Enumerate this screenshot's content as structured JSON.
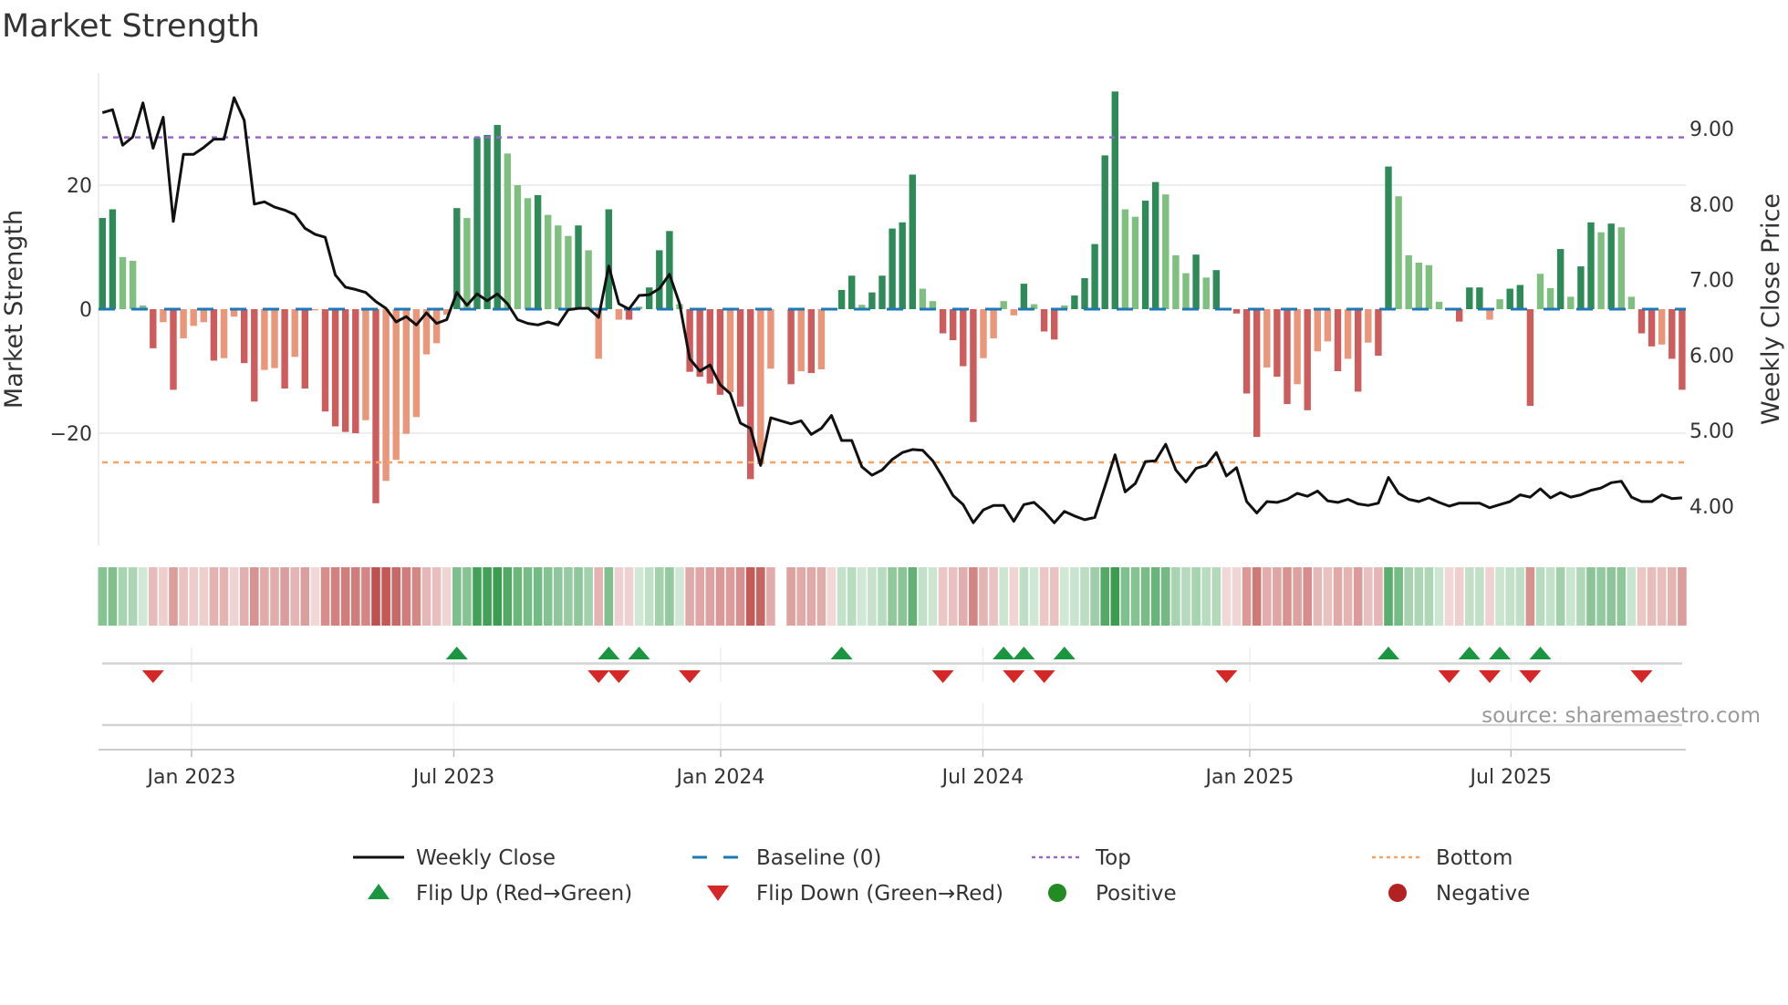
{
  "title": "Market Strength",
  "source": "source: sharemaestro.com",
  "colors": {
    "pos_strong": "#2e8b57",
    "pos_weak": "#7fbf7f",
    "neg_strong": "#cd5c5c",
    "neg_weak": "#e9967a",
    "price_line": "#111111",
    "baseline": "#1f77b4",
    "top": "#9966cc",
    "bottom": "#f4a460",
    "flip_up": "#1a9641",
    "flip_down": "#d62728",
    "positive": "#228b22",
    "negative": "#b22222",
    "strip_green": "#3a9d4f",
    "strip_red": "#c0504d"
  },
  "chart_data": {
    "type": "bar",
    "title": "Market Strength",
    "ylabel": "Market Strength",
    "y2label": "Weekly Close Price",
    "ylim": [
      -38,
      40
    ],
    "y2lim": [
      3.48,
      10.0
    ],
    "y_ticks": [
      {
        "value": 20,
        "label": "20"
      },
      {
        "value": 0,
        "label": "0"
      },
      {
        "value": -20,
        "label": "−20"
      }
    ],
    "y2_ticks": [
      {
        "value": 9,
        "label": "9.00"
      },
      {
        "value": 8,
        "label": "8.00"
      },
      {
        "value": 7,
        "label": "7.00"
      },
      {
        "value": 6,
        "label": "6.00"
      },
      {
        "value": 5,
        "label": "5.00"
      },
      {
        "value": 4,
        "label": "4.00"
      }
    ],
    "x_ticks": [
      "Jan 2023",
      "Jul 2023",
      "Jan 2024",
      "Jul 2024",
      "Jan 2025",
      "Jul 2025"
    ],
    "frequency": "weekly",
    "grid": true,
    "top_level": 27.7,
    "bottom_level": -24.7,
    "baseline": 0,
    "series": [
      {
        "name": "Market Strength",
        "type": "bar",
        "values": [
          14.7,
          16.1,
          8.4,
          7.8,
          0.6,
          -6.3,
          -2.1,
          -13.0,
          -4.7,
          -2.7,
          -2.1,
          -8.3,
          -7.9,
          -1.2,
          -8.7,
          -14.9,
          -9.8,
          -9.5,
          -12.8,
          -7.7,
          -12.8,
          -0.2,
          -16.5,
          -18.9,
          -19.8,
          -20.0,
          -17.9,
          -31.3,
          -27.7,
          -24.3,
          -20.1,
          -17.4,
          -7.3,
          -5.5,
          -0.9,
          16.3,
          14.7,
          27.7,
          28.1,
          29.7,
          25.1,
          20.0,
          17.9,
          18.4,
          15.2,
          13.5,
          11.8,
          13.5,
          9.5,
          -8.0,
          16.1,
          -1.7,
          -1.7,
          0.4,
          3.5,
          9.5,
          12.6,
          0.8,
          -10.1,
          -10.9,
          -12.0,
          -13.8,
          -13.4,
          -15.7,
          -27.4,
          -25.0,
          -9.6,
          null,
          -12.1,
          -10.0,
          -10.3,
          -9.7,
          -0.2,
          3.1,
          5.4,
          0.7,
          2.7,
          5.4,
          13.0,
          14.0,
          21.7,
          3.3,
          1.3,
          -3.9,
          -5.0,
          -9.2,
          -18.2,
          -7.9,
          -4.7,
          1.3,
          -1.0,
          4.1,
          0.8,
          -3.6,
          -4.9,
          0.6,
          2.2,
          5.0,
          10.5,
          24.8,
          35.1,
          16.1,
          14.9,
          17.5,
          20.5,
          18.5,
          8.7,
          5.8,
          8.8,
          5.1,
          6.3,
          -0.2,
          -0.7,
          -13.6,
          -20.6,
          -9.4,
          -10.9,
          -15.3,
          -12.1,
          -16.3,
          -6.8,
          -5.2,
          -10.0,
          -8.0,
          -13.3,
          -5.4,
          -7.5,
          23.0,
          18.2,
          8.7,
          7.5,
          7.1,
          1.2,
          -0.2,
          -2.0,
          3.5,
          3.5,
          -1.7,
          1.6,
          3.3,
          3.9,
          -15.6,
          5.7,
          3.4,
          9.7,
          2.0,
          6.9,
          14.0,
          12.4,
          13.8,
          13.2,
          2.0,
          -3.9,
          -6.0,
          -5.7,
          -8.0,
          -13.0
        ]
      },
      {
        "name": "Weekly Close",
        "type": "line",
        "axis": "right",
        "values": [
          9.21,
          9.25,
          8.78,
          8.89,
          9.34,
          8.74,
          9.15,
          7.77,
          8.66,
          8.66,
          8.75,
          8.86,
          8.86,
          9.41,
          9.11,
          8.0,
          8.03,
          7.96,
          7.92,
          7.86,
          7.68,
          7.6,
          7.56,
          7.06,
          6.9,
          6.87,
          6.83,
          6.71,
          6.62,
          6.44,
          6.51,
          6.4,
          6.56,
          6.42,
          6.47,
          6.83,
          6.66,
          6.81,
          6.72,
          6.81,
          6.68,
          6.47,
          6.42,
          6.4,
          6.44,
          6.4,
          6.6,
          6.62,
          6.62,
          6.5,
          7.18,
          6.68,
          6.61,
          6.79,
          6.8,
          6.88,
          7.07,
          6.68,
          5.95,
          5.79,
          5.87,
          5.61,
          5.49,
          5.1,
          5.03,
          4.54,
          5.17,
          5.13,
          5.09,
          5.13,
          4.95,
          5.03,
          5.2,
          4.87,
          4.87,
          4.52,
          4.41,
          4.48,
          4.62,
          4.71,
          4.75,
          4.74,
          4.6,
          4.38,
          4.14,
          4.02,
          3.78,
          3.95,
          4.01,
          4.01,
          3.8,
          4.02,
          4.05,
          3.93,
          3.78,
          3.93,
          3.87,
          3.82,
          3.85,
          4.26,
          4.68,
          4.19,
          4.3,
          4.59,
          4.6,
          4.82,
          4.48,
          4.32,
          4.5,
          4.54,
          4.71,
          4.4,
          4.51,
          4.06,
          3.91,
          4.06,
          4.05,
          4.09,
          4.17,
          4.13,
          4.2,
          4.07,
          4.05,
          4.09,
          4.03,
          4.01,
          4.04,
          4.38,
          4.17,
          4.09,
          4.06,
          4.11,
          4.05,
          4.0,
          4.04,
          4.04,
          4.04,
          3.98,
          4.02,
          4.06,
          4.15,
          4.12,
          4.23,
          4.11,
          4.18,
          4.12,
          4.15,
          4.21,
          4.24,
          4.31,
          4.33,
          4.12,
          4.06,
          4.06,
          4.15,
          4.1,
          4.11
        ]
      }
    ],
    "legend": {
      "placement": "bottom",
      "items": [
        {
          "label": "Weekly Close",
          "kind": "line"
        },
        {
          "label": "Baseline (0)",
          "kind": "dashed"
        },
        {
          "label": "Top",
          "kind": "dotted-top"
        },
        {
          "label": "Bottom",
          "kind": "dotted-bottom"
        },
        {
          "label": "Flip Up (Red→Green)",
          "kind": "tri-up"
        },
        {
          "label": "Flip Down (Green→Red)",
          "kind": "tri-down"
        },
        {
          "label": "Positive",
          "kind": "dot-pos"
        },
        {
          "label": "Negative",
          "kind": "dot-neg"
        }
      ]
    }
  }
}
